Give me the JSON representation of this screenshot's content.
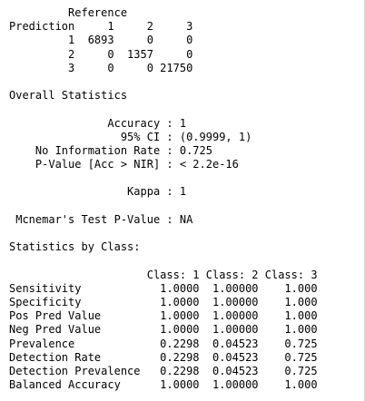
{
  "console": {
    "text_color": "#000000",
    "background_color": "#ffffff",
    "lines": [
      "         Reference",
      "Prediction     1     2     3",
      "         1  6893     0     0",
      "         2     0  1357     0",
      "         3     0     0 21750",
      "",
      "Overall Statistics",
      "",
      "               Accuracy : 1",
      "                 95% CI : (0.9999, 1)",
      "    No Information Rate : 0.725",
      "    P-Value [Acc > NIR] : < 2.2e-16",
      "",
      "                  Kappa : 1",
      "",
      " Mcnemar's Test P-Value : NA",
      "",
      "Statistics by Class:",
      "",
      "                     Class: 1 Class: 2 Class: 3",
      "Sensitivity            1.0000  1.00000    1.000",
      "Specificity            1.0000  1.00000    1.000",
      "Pos Pred Value         1.0000  1.00000    1.000",
      "Neg Pred Value         1.0000  1.00000    1.000",
      "Prevalence             0.2298  0.04523    0.725",
      "Detection Rate         0.2298  0.04523    0.725",
      "Detection Prevalence   0.2298  0.04523    0.725",
      "Balanced Accuracy      1.0000  1.00000    1.000"
    ]
  }
}
